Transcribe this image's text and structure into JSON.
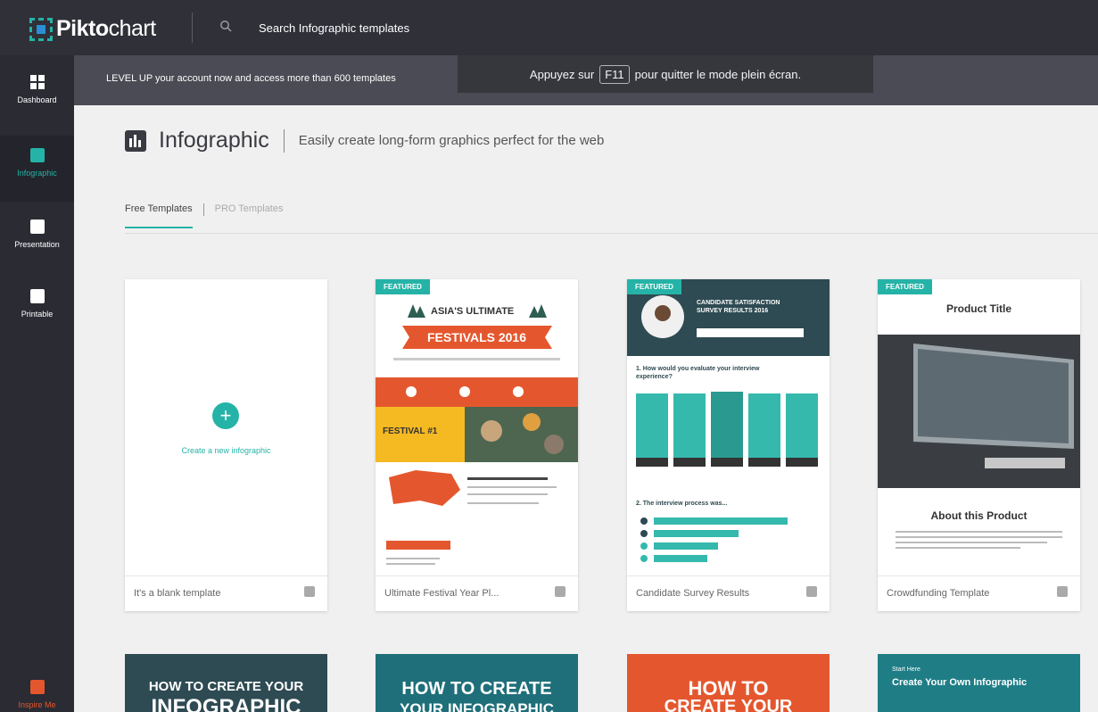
{
  "topbar": {
    "logo": "Piktochart",
    "logo_bold": "Pikto",
    "logo_light": "chart",
    "search_placeholder": "Search Infographic templates"
  },
  "sidebar": {
    "items": [
      {
        "label": "Dashboard",
        "icon": "grid-icon"
      },
      {
        "label": "Infographic",
        "icon": "infographic-icon"
      },
      {
        "label": "Presentation",
        "icon": "chart-icon"
      },
      {
        "label": "Printable",
        "icon": "printable-icon"
      },
      {
        "label": "Inspire Me",
        "icon": "inspire-icon"
      }
    ]
  },
  "banner": {
    "text": "LEVEL UP your account now and access more than 600 templates"
  },
  "fullscreen_tip": {
    "before": "Appuyez sur",
    "key": "F11",
    "after": "pour quitter le mode plein écran."
  },
  "page": {
    "title": "Infographic",
    "subtitle": "Easily create long-form graphics perfect for the web"
  },
  "tabs": [
    "Free Templates",
    "PRO Templates"
  ],
  "badge_label": "FEATURED",
  "cards": [
    {
      "name": "It's a blank template",
      "create_label": "Create a new infographic"
    },
    {
      "name": "Ultimate Festival Year Pl...",
      "thumb_title_1": "ASIA'S ULTIMATE",
      "thumb_title_2": "FESTIVALS 2016",
      "thumb_sub": "FESTIVAL #1"
    },
    {
      "name": "Candidate Survey Results",
      "thumb_title": "CANDIDATE SATISFACTION SURVEY RESULTS 2016",
      "thumb_q1": "1. How would you evaluate your interview experience?",
      "thumb_q2": "2. The interview process was..."
    },
    {
      "name": "Crowdfunding Template",
      "thumb_title": "Product Title",
      "thumb_about": "About this Product"
    }
  ],
  "row2": [
    {
      "line1": "HOW TO CREATE YOUR",
      "line2": "INFOGRAPHIC"
    },
    {
      "line1": "HOW TO CREATE",
      "line2": "YOUR INFOGRAPHIC"
    },
    {
      "line1": "HOW TO",
      "line2": "CREATE YOUR"
    },
    {
      "line0": "Start Here",
      "line1": "Create Your Own Infographic"
    }
  ],
  "colors": {
    "accent": "#25b3a7",
    "topbar": "#2f3038",
    "sidebar": "#2a2b33",
    "festival_orange": "#e4572e",
    "survey_teal": "#35b9ad",
    "dark_slate": "#2e4a52"
  }
}
